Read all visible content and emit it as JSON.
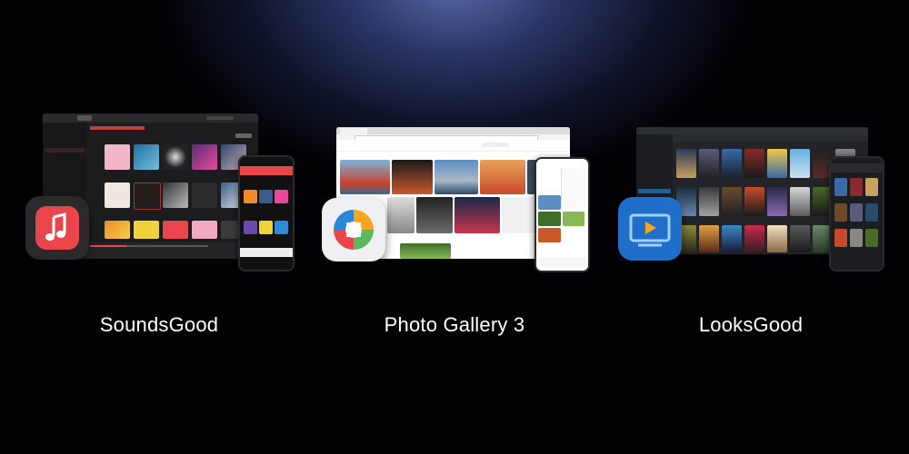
{
  "products": [
    {
      "name": "SoundsGood"
    },
    {
      "name": "Photo Gallery 3"
    },
    {
      "name": "LooksGood"
    }
  ],
  "colors": {
    "background": "#030306",
    "glow": "#5a6aa8",
    "soundsgood_accent": "#e8464a",
    "photo_accent": "#f5a623",
    "looksgood_accent": "#2b88d8"
  },
  "icons": {
    "soundsgood": "music-note-icon",
    "photo_gallery": "photo-gallery-icon",
    "looksgood": "play-screen-icon"
  }
}
